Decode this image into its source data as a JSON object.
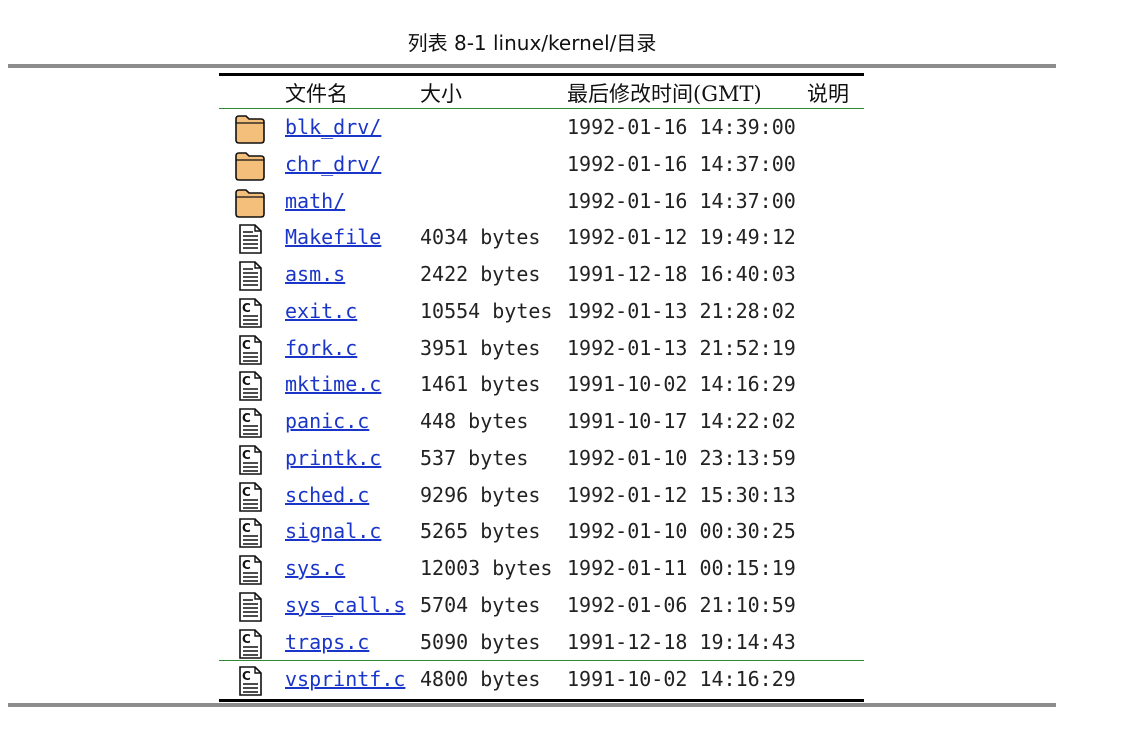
{
  "caption": "列表 8-1 linux/kernel/目录",
  "columns": {
    "name": "文件名",
    "size": "大小",
    "modified": "最后修改时间(GMT)",
    "description": "说明"
  },
  "files": [
    {
      "name": "blk_drv/",
      "size": "",
      "modified": "1992-01-16 14:39:00",
      "icon": "folder-icon"
    },
    {
      "name": "chr_drv/",
      "size": "",
      "modified": "1992-01-16 14:37:00",
      "icon": "folder-icon"
    },
    {
      "name": "math/",
      "size": "",
      "modified": "1992-01-16 14:37:00",
      "icon": "folder-icon"
    },
    {
      "name": "Makefile",
      "size": "4034 bytes",
      "modified": "1992-01-12 19:49:12",
      "icon": "text-file-icon"
    },
    {
      "name": "asm.s",
      "size": "2422 bytes",
      "modified": "1991-12-18 16:40:03",
      "icon": "text-file-icon"
    },
    {
      "name": "exit.c",
      "size": "10554 bytes",
      "modified": "1992-01-13 21:28:02",
      "icon": "c-source-file-icon"
    },
    {
      "name": "fork.c",
      "size": "3951 bytes",
      "modified": "1992-01-13 21:52:19",
      "icon": "c-source-file-icon"
    },
    {
      "name": "mktime.c",
      "size": "1461 bytes",
      "modified": "1991-10-02 14:16:29",
      "icon": "c-source-file-icon"
    },
    {
      "name": "panic.c",
      "size": "448 bytes",
      "modified": "1991-10-17 14:22:02",
      "icon": "c-source-file-icon"
    },
    {
      "name": "printk.c",
      "size": "537 bytes",
      "modified": "1992-01-10 23:13:59",
      "icon": "c-source-file-icon"
    },
    {
      "name": "sched.c",
      "size": "9296 bytes",
      "modified": "1992-01-12 15:30:13",
      "icon": "c-source-file-icon"
    },
    {
      "name": "signal.c",
      "size": "5265 bytes",
      "modified": "1992-01-10 00:30:25",
      "icon": "c-source-file-icon"
    },
    {
      "name": "sys.c",
      "size": "12003 bytes",
      "modified": "1992-01-11 00:15:19",
      "icon": "c-source-file-icon"
    },
    {
      "name": "sys_call.s",
      "size": "5704 bytes",
      "modified": "1992-01-06 21:10:59",
      "icon": "text-file-icon"
    },
    {
      "name": "traps.c",
      "size": "5090 bytes",
      "modified": "1991-12-18 19:14:43",
      "icon": "c-source-file-icon"
    },
    {
      "name": "vsprintf.c",
      "size": "4800 bytes",
      "modified": "1991-10-02 14:16:29",
      "icon": "c-source-file-icon"
    }
  ]
}
